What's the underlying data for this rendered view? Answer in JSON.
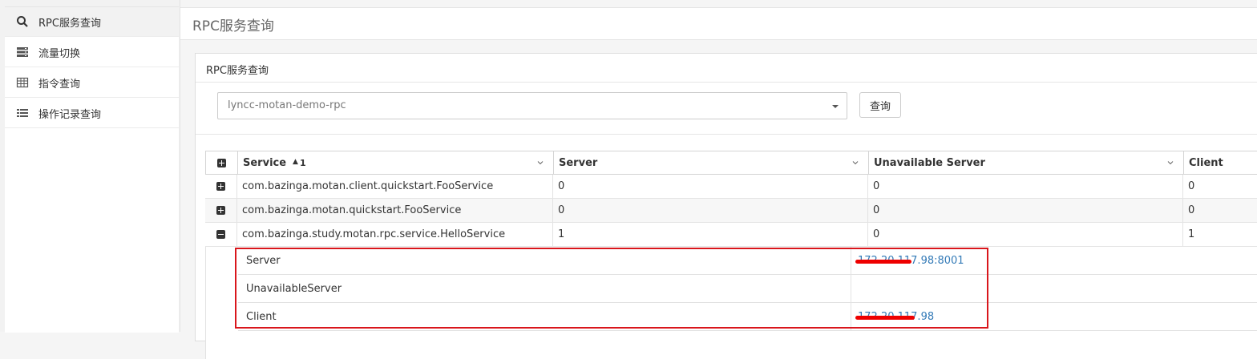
{
  "sidebar": {
    "items": [
      {
        "label": "RPC服务查询",
        "icon": "search-icon",
        "active": true
      },
      {
        "label": "流量切换",
        "icon": "server-icon",
        "active": false
      },
      {
        "label": "指令查询",
        "icon": "table-icon",
        "active": false
      },
      {
        "label": "操作记录查询",
        "icon": "list-icon",
        "active": false
      }
    ]
  },
  "header": {
    "title": "RPC服务查询"
  },
  "panel": {
    "title": "RPC服务查询",
    "select_value": "lyncc-motan-demo-rpc",
    "query_button": "查询"
  },
  "grid": {
    "columns": [
      "Service",
      "Server",
      "Unavailable Server",
      "Client"
    ],
    "sort": {
      "column": "Service",
      "order_number": "1",
      "direction": "ascending"
    },
    "rows": [
      {
        "service": "com.bazinga.motan.client.quickstart.FooService",
        "server": "0",
        "unavailable": "0",
        "client": "0",
        "expanded": false
      },
      {
        "service": "com.bazinga.motan.quickstart.FooService",
        "server": "0",
        "unavailable": "0",
        "client": "0",
        "expanded": false
      },
      {
        "service": "com.bazinga.study.motan.rpc.service.HelloService",
        "server": "1",
        "unavailable": "0",
        "client": "1",
        "expanded": true
      }
    ],
    "detail": [
      {
        "key": "Server",
        "value": "172.20.117.98:8001"
      },
      {
        "key": "UnavailableServer",
        "value": ""
      },
      {
        "key": "Client",
        "value": "172.20.117.98"
      }
    ]
  },
  "colors": {
    "accent_link": "#337ab7",
    "highlight_box": "#d9161c",
    "redaction": "#e00000"
  }
}
